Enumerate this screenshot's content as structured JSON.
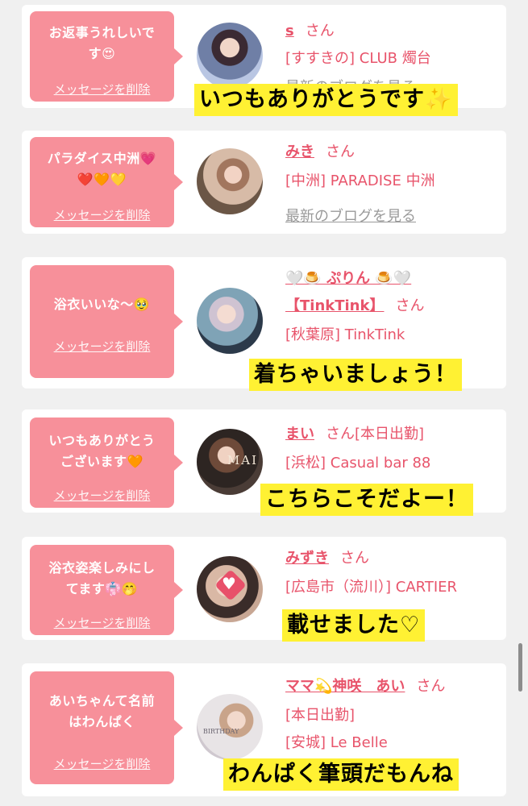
{
  "messages": [
    {
      "bubble_text": "お返事うれしいで\nす😍",
      "delete_label": "メッセージを削除",
      "name": "s",
      "honorific": "さん",
      "line2": "[すすきの] CLUB 燭台",
      "line3": "最新のブログを見る",
      "caption": "いつもありがとうです✨"
    },
    {
      "bubble_text": "パラダイス中洲💗\n❤️🧡💛",
      "delete_label": "メッセージを削除",
      "name": "みき",
      "honorific": "さん",
      "line2": "[中洲] PARADISE 中洲",
      "line3": "最新のブログを見る"
    },
    {
      "bubble_text": "浴衣いいな〜🥹",
      "delete_label": "メッセージを削除",
      "name_line1": "🤍🍮 ぷりん 🍮🤍",
      "name_line2": "【TinkTink】",
      "honorific": "さん",
      "line2": "[秋葉原] TinkTink",
      "caption": "着ちゃいましょう！"
    },
    {
      "bubble_text": "いつもありがとう\nございます🧡",
      "delete_label": "メッセージを削除",
      "name": "まい",
      "honorific": "さん",
      "status": "[本日出勤]",
      "line2": "[浜松] Casual bar 88",
      "caption": "こちらこそだよー！",
      "avatar_text": "MAI"
    },
    {
      "bubble_text": "浴衣姿楽しみにし\nてます👘🤭",
      "delete_label": "メッセージを削除",
      "name": "みずき",
      "honorific": "さん",
      "line2": "[広島市（流川）] CARTIER",
      "caption": "載せました♡"
    },
    {
      "bubble_text": "あいちゃんて名前\nはわんぱく",
      "delete_label": "メッセージを削除",
      "name": "ママ💫神咲　あい",
      "honorific": "さん",
      "line2": "[本日出勤]",
      "line3": "[安城] Le Belle",
      "caption": "わんぱく筆頭だもんね",
      "avatar_text": "BIRTHDAY"
    }
  ],
  "colors": {
    "bubble": "#f7909a",
    "name_pink": "#e8546b",
    "caption_yellow": "#fff133",
    "page_bg": "#f0f0f0"
  }
}
